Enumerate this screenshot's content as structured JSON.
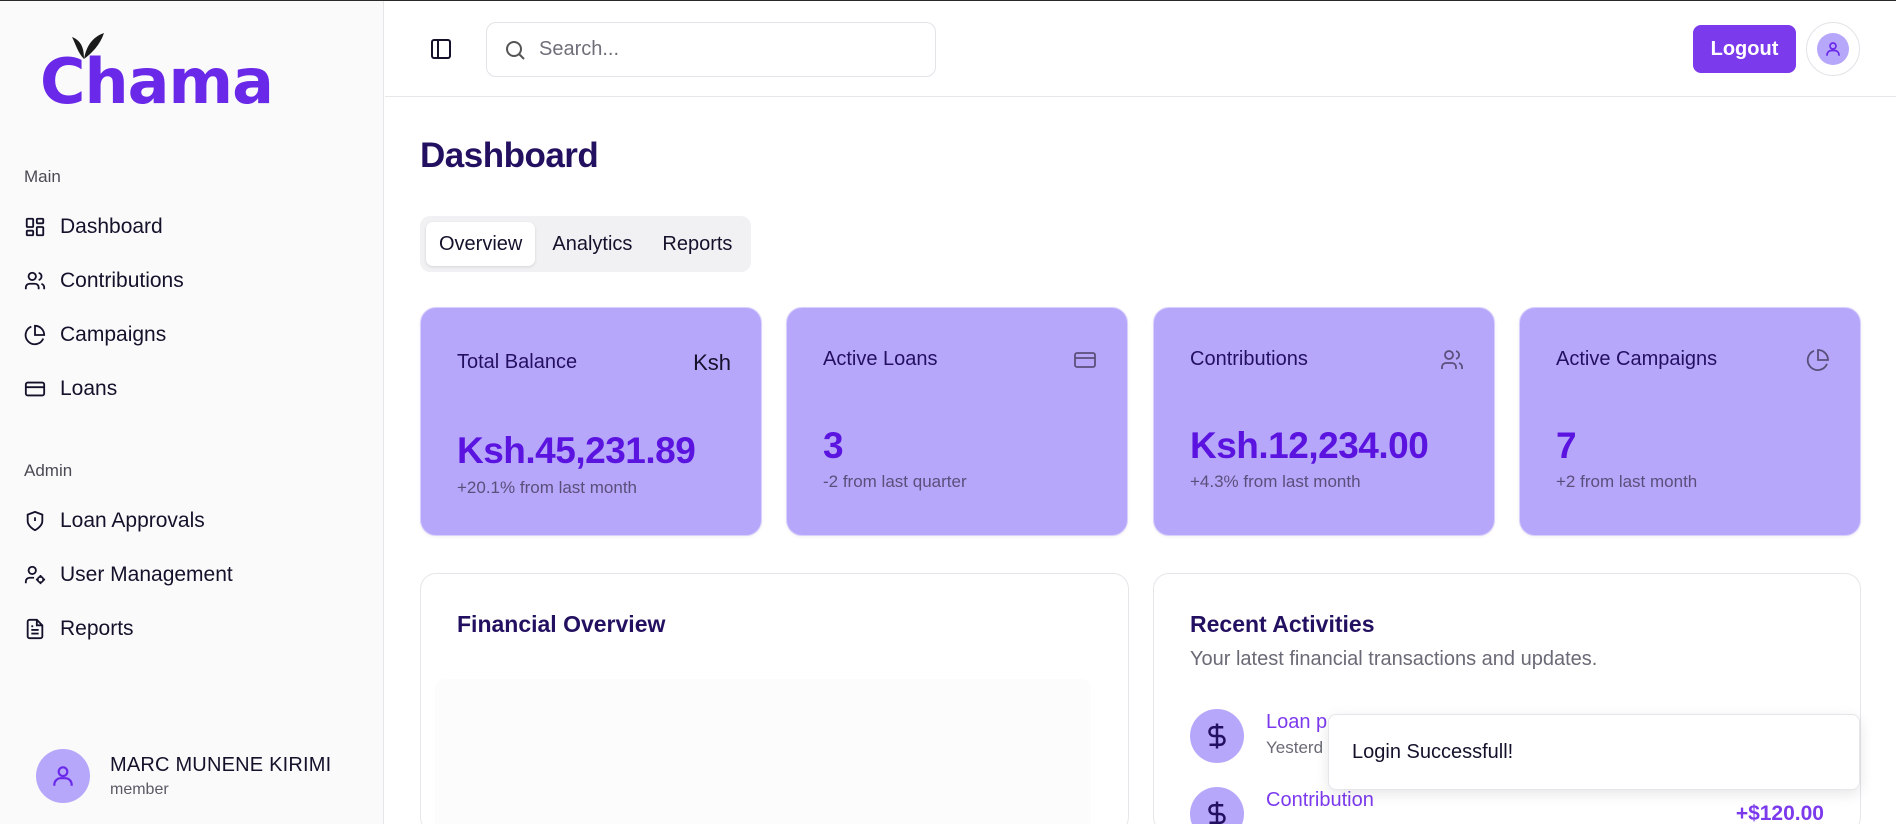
{
  "app": {
    "logo_text": "Chama",
    "brand_color": "#7c3aed",
    "card_color": "#b7a7fb"
  },
  "sidebar": {
    "main_label": "Main",
    "main_items": [
      {
        "label": "Dashboard",
        "icon": "dashboard-grid-icon"
      },
      {
        "label": "Contributions",
        "icon": "users-icon"
      },
      {
        "label": "Campaigns",
        "icon": "pie-chart-icon"
      },
      {
        "label": "Loans",
        "icon": "credit-card-icon"
      }
    ],
    "admin_label": "Admin",
    "admin_items": [
      {
        "label": "Loan Approvals",
        "icon": "shield-icon"
      },
      {
        "label": "User Management",
        "icon": "user-cog-icon"
      },
      {
        "label": "Reports",
        "icon": "file-text-icon"
      }
    ],
    "user": {
      "name": "MARC MUNENE KIRIMI",
      "role": "member"
    }
  },
  "header": {
    "search_placeholder": "Search...",
    "logout_label": "Logout"
  },
  "main": {
    "title": "Dashboard",
    "tabs": [
      {
        "label": "Overview",
        "active": true
      },
      {
        "label": "Analytics",
        "active": false
      },
      {
        "label": "Reports",
        "active": false
      }
    ],
    "cards": [
      {
        "title": "Total Balance",
        "icon_text": "Ksh",
        "value": "Ksh.45,231.89",
        "sub": "+20.1% from last month"
      },
      {
        "title": "Active Loans",
        "icon": "credit-card-icon",
        "value": "3",
        "sub": "-2 from last quarter"
      },
      {
        "title": "Contributions",
        "icon": "users-icon",
        "value": "Ksh.12,234.00",
        "sub": "+4.3% from last month"
      },
      {
        "title": "Active Campaigns",
        "icon": "pie-chart-icon",
        "value": "7",
        "sub": "+2 from last month"
      }
    ],
    "financial_overview": {
      "title": "Financial Overview"
    },
    "recent_activities": {
      "title": "Recent Activities",
      "subtitle": "Your latest financial transactions and updates.",
      "items": [
        {
          "title": "Loan p",
          "time": "Yesterd",
          "icon": "dollar-icon"
        },
        {
          "title": "Contribution",
          "time": "",
          "amount": "+$120.00",
          "icon": "dollar-icon"
        }
      ]
    }
  },
  "toast": {
    "message": "Login Successfull!"
  }
}
